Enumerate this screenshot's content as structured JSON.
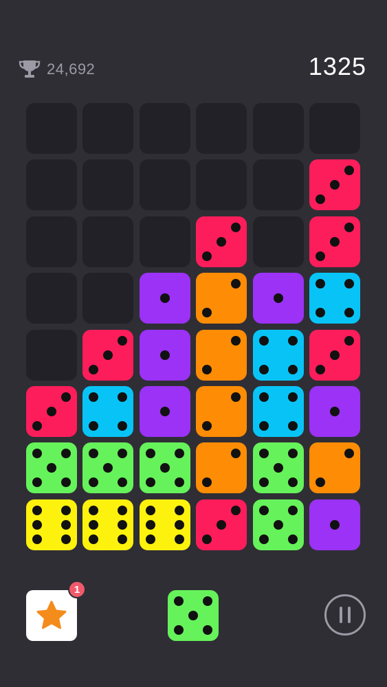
{
  "header": {
    "best_score": "24,692",
    "score": "1325",
    "trophy_icon": "trophy-icon"
  },
  "colors": {
    "background": "#2f2e35",
    "empty_cell": "#222127",
    "red": "#fe1d5b",
    "orange": "#fe8c05",
    "purple": "#9b32f6",
    "blue": "#08c4f6",
    "green": "#66f25a",
    "yellow": "#fdf20d"
  },
  "board": {
    "columns": 6,
    "rows": 8,
    "cells": [
      [
        0,
        0,
        0,
        0,
        0,
        0
      ],
      [
        0,
        0,
        0,
        0,
        0,
        3
      ],
      [
        0,
        0,
        0,
        3,
        0,
        3
      ],
      [
        0,
        0,
        1,
        2,
        1,
        4
      ],
      [
        0,
        3,
        1,
        2,
        4,
        3
      ],
      [
        3,
        4,
        1,
        2,
        4,
        1
      ],
      [
        5,
        5,
        5,
        2,
        5,
        2
      ],
      [
        6,
        6,
        6,
        3,
        5,
        1
      ]
    ]
  },
  "bottom_bar": {
    "powerup_icon": "star-icon",
    "powerup_badge": "1",
    "next_die_value": 5,
    "pause_icon": "pause-icon"
  }
}
